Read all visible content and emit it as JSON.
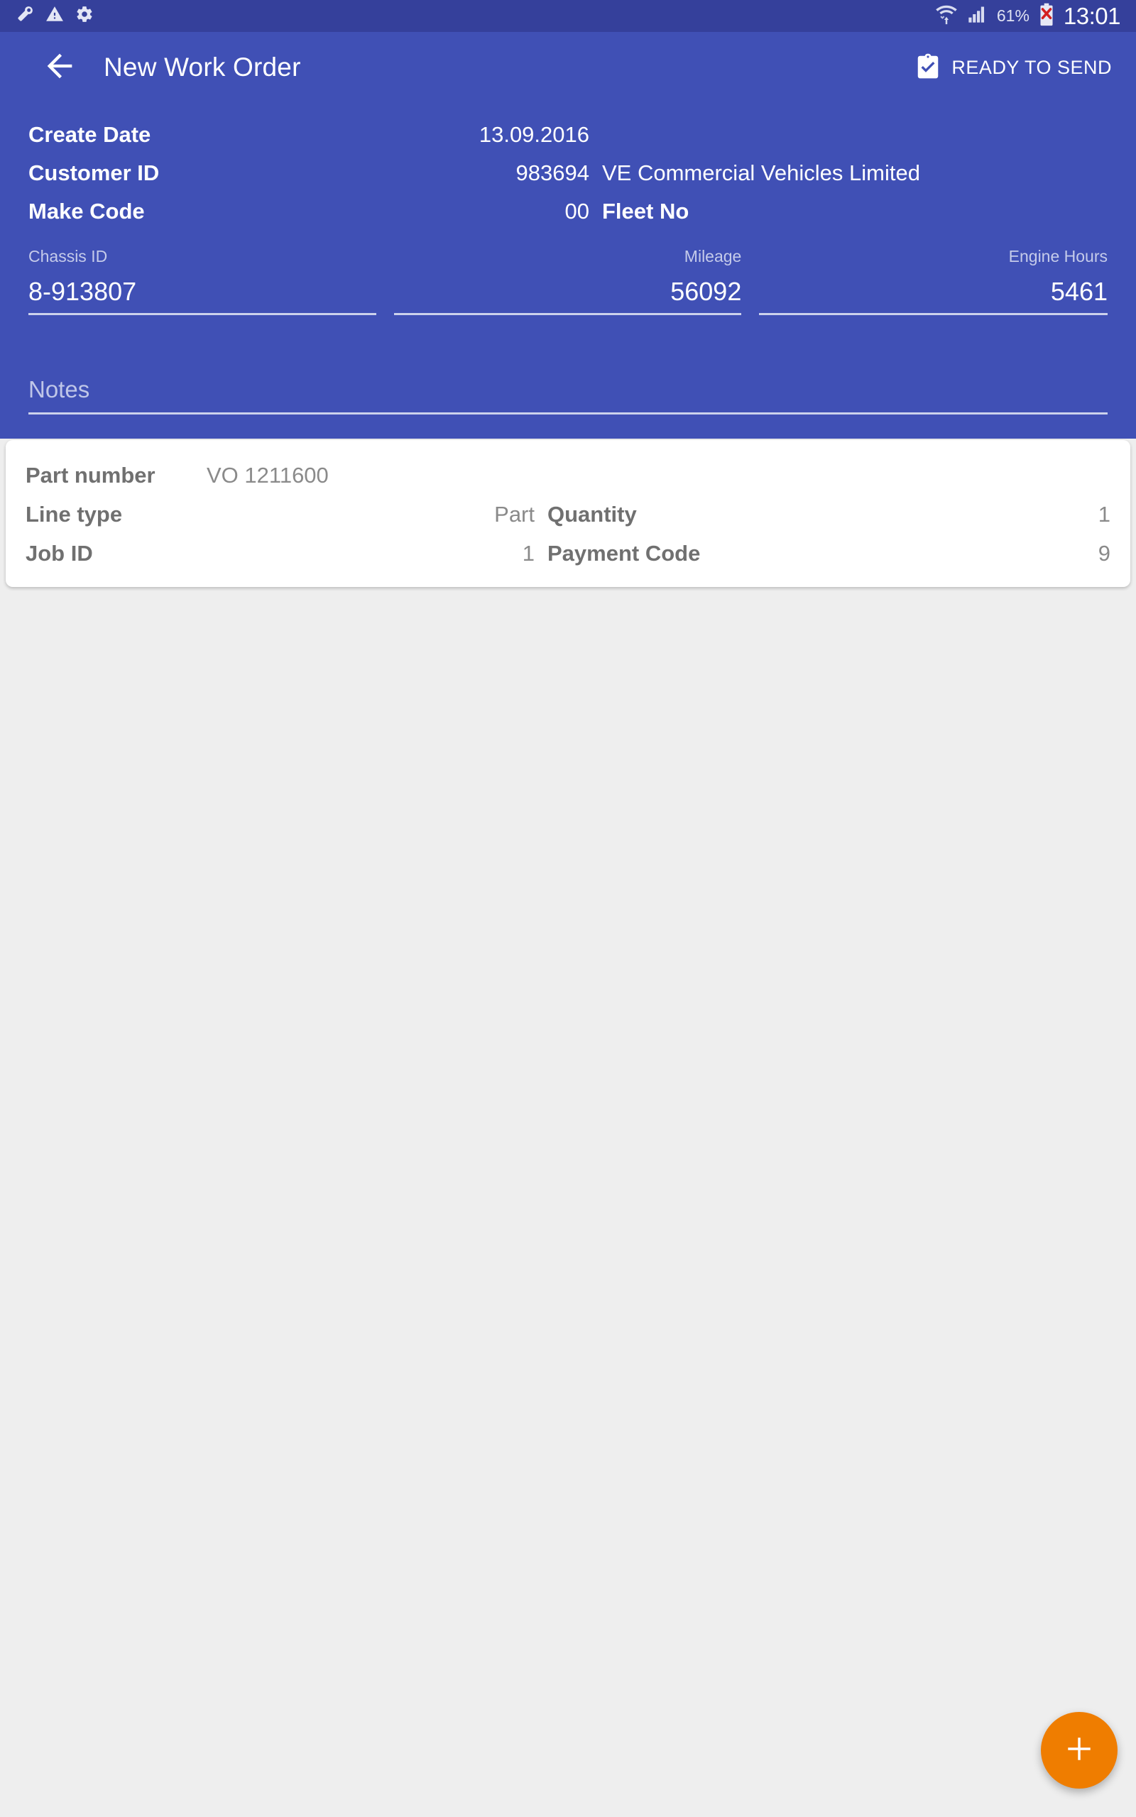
{
  "status_bar": {
    "left_icons": [
      "wrench-icon",
      "warning-triangle-icon",
      "gear-icon"
    ],
    "wifi_icon": "wifi-icon",
    "signal_icon": "cellular-signal-icon",
    "battery_percent": "61%",
    "battery_icon": "battery-error-icon",
    "time": "13:01"
  },
  "appbar": {
    "back_icon": "back-arrow-icon",
    "title": "New Work Order",
    "action_icon": "clipboard-check-icon",
    "action_label": "READY TO SEND"
  },
  "header_info": [
    {
      "label": "Create Date",
      "value": "13.09.2016",
      "extra": "",
      "extra_bold": false
    },
    {
      "label": "Customer ID",
      "value": "983694",
      "extra": "VE Commercial Vehicles Limited",
      "extra_bold": false
    },
    {
      "label": "Make Code",
      "value": "00",
      "extra": "Fleet No",
      "extra_bold": true
    }
  ],
  "fields": {
    "chassis": {
      "label": "Chassis ID",
      "value": "8-913807"
    },
    "mileage": {
      "label": "Mileage",
      "value": "56092"
    },
    "engine": {
      "label": "Engine Hours",
      "value": "5461"
    }
  },
  "notes": {
    "placeholder": "Notes",
    "value": ""
  },
  "line_card": {
    "rows": [
      {
        "left_label": "Part number",
        "left_value": "VO 1211600",
        "mid_label": "",
        "right_value": ""
      },
      {
        "left_label": "Line type",
        "left_value": "Part",
        "mid_label": "Quantity",
        "right_value": "1"
      },
      {
        "left_label": "Job ID",
        "left_value": "1",
        "mid_label": "Payment Code",
        "right_value": "9"
      }
    ]
  },
  "fab": {
    "icon": "plus-icon",
    "color": "#ef7d00"
  },
  "colors": {
    "status_bar": "#35409b",
    "header": "#4050b5",
    "background": "#eeeeee",
    "card": "#ffffff",
    "accent": "#ef7d00"
  }
}
